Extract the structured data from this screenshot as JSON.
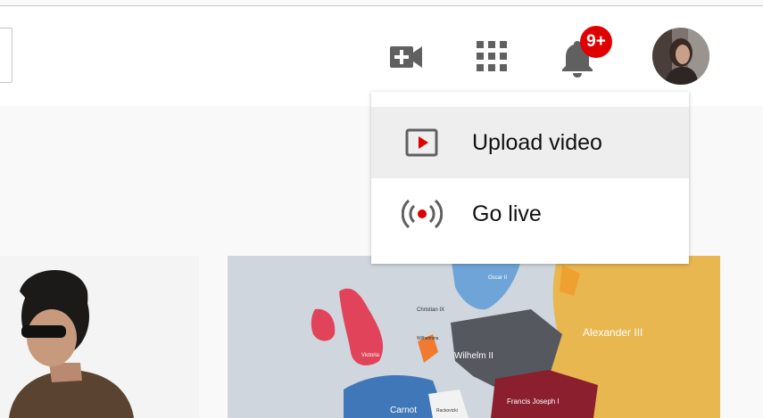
{
  "header": {
    "icons": {
      "create": "video-camera-plus-icon",
      "apps": "apps-grid-icon",
      "notifications": "bell-icon"
    },
    "notification_badge": "9+",
    "colors": {
      "badge": "#e00000",
      "icon": "#606060"
    }
  },
  "create_menu": {
    "items": [
      {
        "label": "Upload video",
        "icon": "upload-video-icon"
      },
      {
        "label": "Go live",
        "icon": "go-live-icon"
      }
    ],
    "colors": {
      "accent": "#e00000",
      "hover": "#eeeeee"
    }
  },
  "thumbnails": {
    "map_labels": [
      "Christian IX",
      "Oscar II",
      "Wilhelmina",
      "Victoria",
      "Wilhelm II",
      "Alexander III",
      "Francis Joseph I",
      "Carnot",
      "Rackovicki"
    ]
  }
}
